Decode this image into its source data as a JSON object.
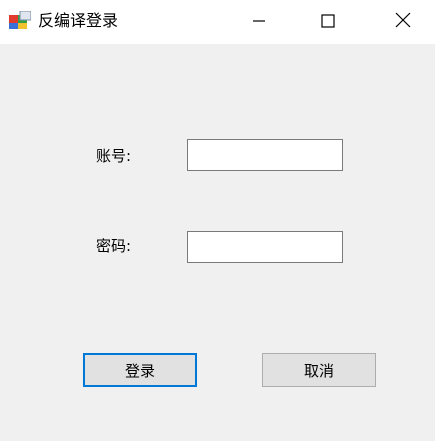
{
  "window": {
    "title": "反编译登录",
    "icon": "winforms-app-icon",
    "controls": {
      "minimize_icon": "minimize-icon",
      "maximize_icon": "maximize-icon",
      "close_icon": "close-icon"
    }
  },
  "form": {
    "account_label": "账号:",
    "account_value": "",
    "password_label": "密码:",
    "password_value": "",
    "login_button": "登录",
    "cancel_button": "取消"
  },
  "colors": {
    "window_bg": "#f0f0f0",
    "titlebar_bg": "#ffffff",
    "button_bg": "#e1e1e1",
    "focus_border": "#0078d7"
  }
}
